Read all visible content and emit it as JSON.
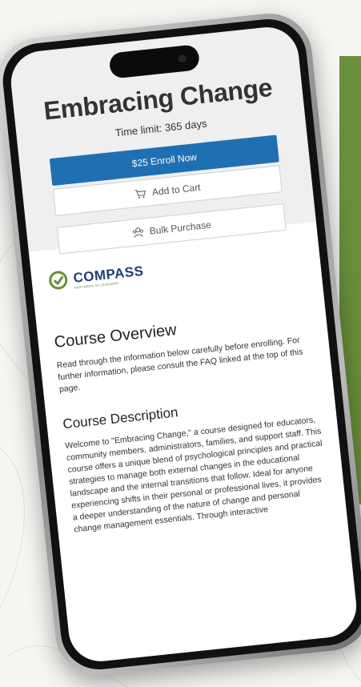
{
  "course": {
    "title": "Embracing Change",
    "time_limit": "Time limit: 365 days"
  },
  "actions": {
    "enroll_label": "$25 Enroll Now",
    "cart_label": "Add to Cart",
    "bulk_label": "Bulk Purchase"
  },
  "logo": {
    "name": "COMPASS",
    "tagline": "PARTNERS IN LEARNING"
  },
  "overview": {
    "heading": "Course Overview",
    "text": "Read through the information below carefully before enrolling. For further information, please consult the FAQ linked at the top of this page."
  },
  "description": {
    "heading": "Course Description",
    "text": "Welcome to \"Embracing Change,\" a course designed for educators, community members, administrators, families, and support staff. This course offers a unique blend of psychological principles and practical strategies to manage both external changes in the educational landscape and the internal transitions that follow. Ideal for anyone experiencing shifts in their personal or professional lives, it provides a deeper understanding of the nature of change and personal change management essentials. Through interactive"
  },
  "colors": {
    "primary_button": "#1f6fb3",
    "accent_green": "#6a8f3a",
    "logo_navy": "#1f3f74"
  },
  "icons": [
    "cart-icon",
    "people-icon",
    "compass-logo-icon"
  ]
}
